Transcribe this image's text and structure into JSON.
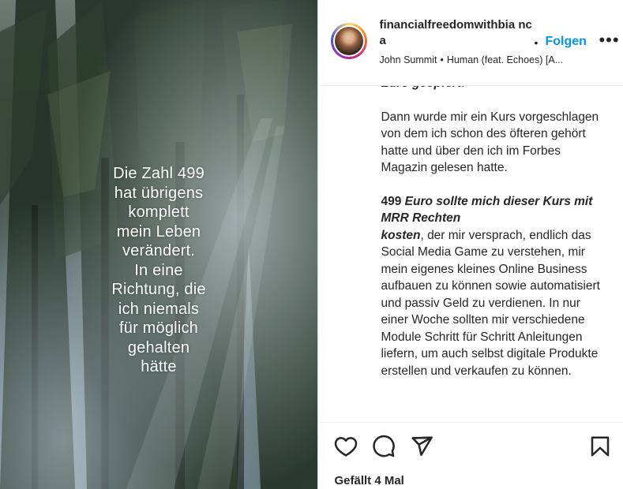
{
  "post": {
    "image_caption": "Die Zahl 499\nhat übrigens\nkomplett\nmein Leben\nverändert.\nIn eine\nRichtung, die\nich niemals\nfür möglich\ngehalten\nhätte"
  },
  "header": {
    "username": "financialfreedomwithbia nca",
    "dot": "•",
    "follow_label": "Folgen",
    "more_label": "•••",
    "music_artist": "John Summit",
    "music_sep": "•",
    "music_track": "Human (feat. Echoes) [A..."
  },
  "caption": {
    "top_fragment": "Euro geopfert",
    "top_period": ".",
    "p1": "Dann wurde mir ein Kurs vorgeschlagen von dem ich schon des öfteren gehört hatte und über den ich im Forbes Magazin gelesen hatte.",
    "p2_bold": "499 ",
    "p2_bi1": "Euro sollte mich dieser Kurs mit MRR Rechten",
    "p2_bi2": "kosten",
    "p2_rest": ", der mir versprach, endlich das Social Media Game zu verstehen, mir mein eigenes kleines Online Business aufbauen zu können sowie automatisiert und passiv Geld zu verdienen. In nur einer Woche sollten mir verschiedene Module Schritt für Schritt Anleitungen liefern, um auch selbst digitale Produkte erstellen und verkaufen zu können."
  },
  "actions": {
    "icons": [
      "heart-icon",
      "comment-icon",
      "share-icon",
      "bookmark-icon"
    ]
  },
  "likes": {
    "text": "Gefällt 4 Mal"
  }
}
